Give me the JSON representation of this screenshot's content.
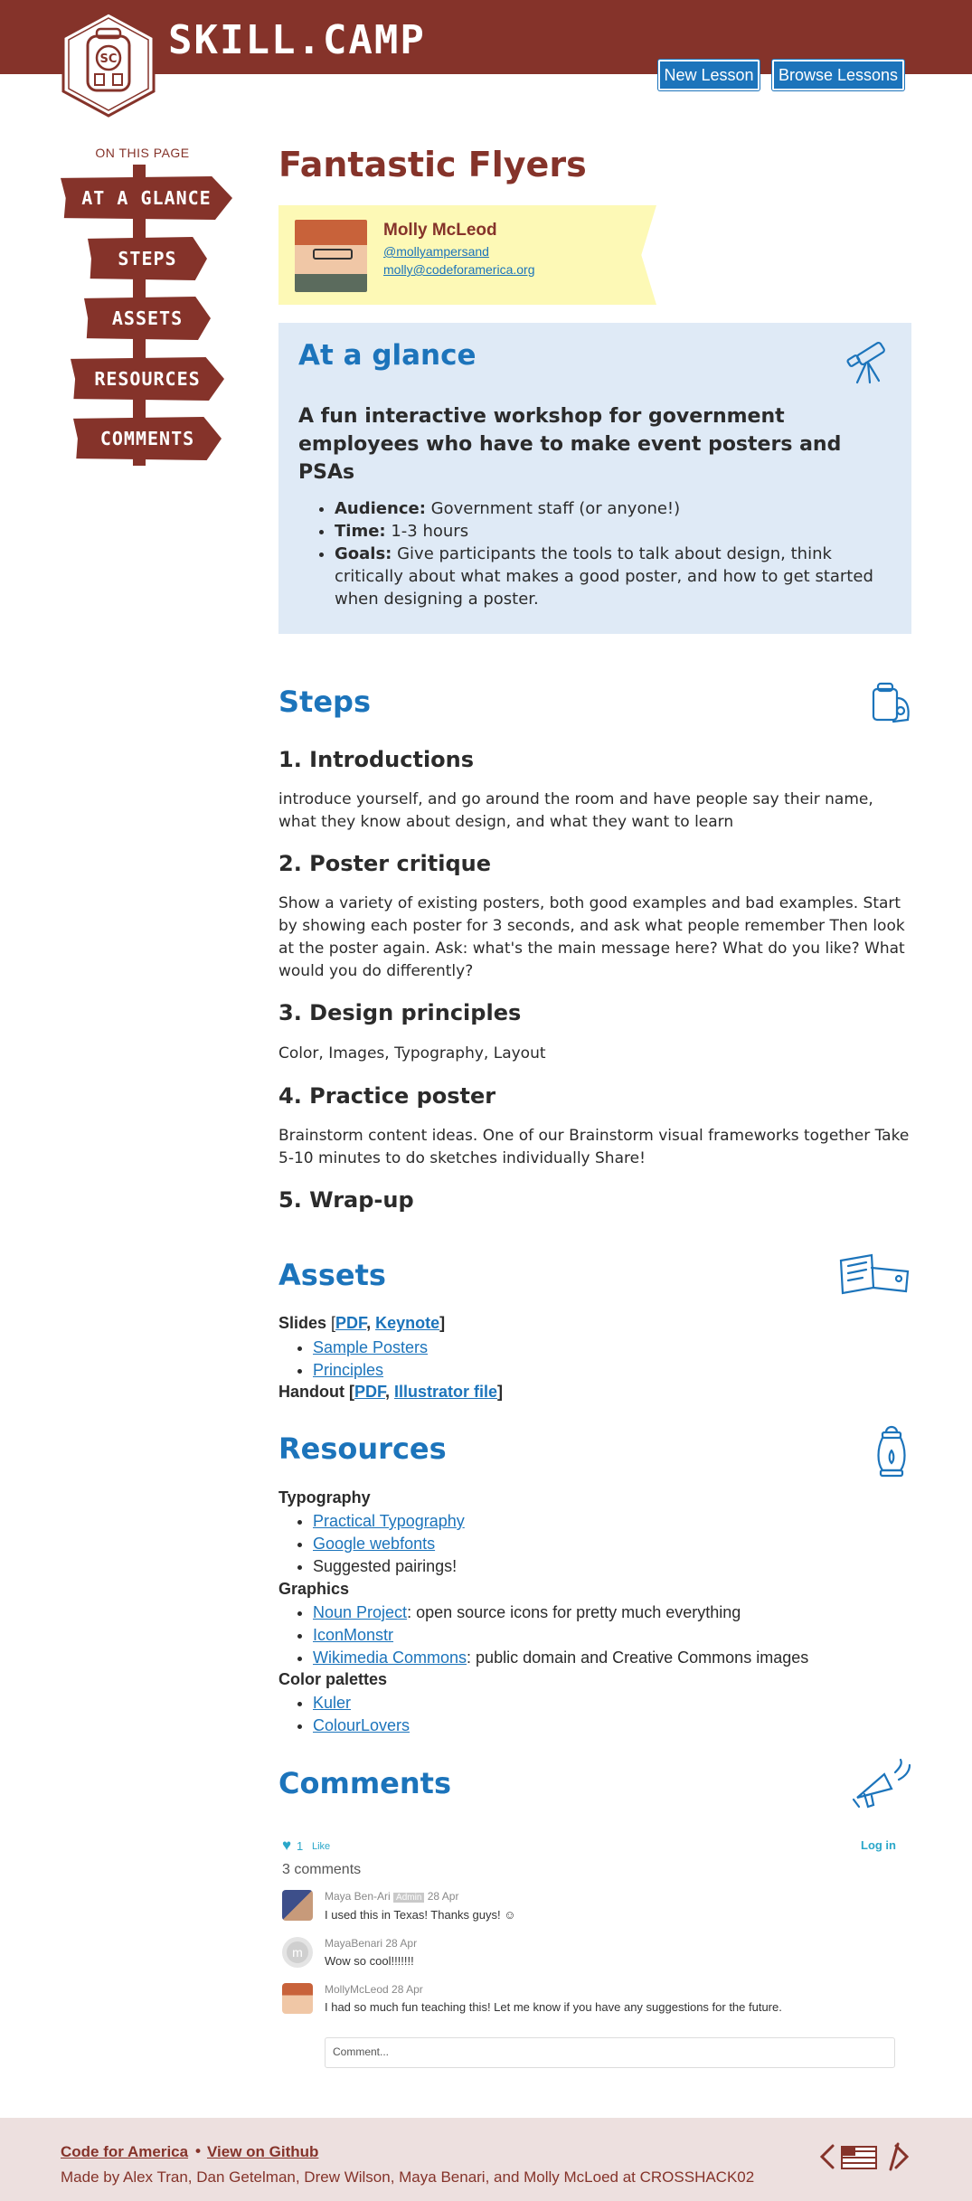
{
  "header": {
    "brand": "SKILL.CAMP",
    "badge_text": "SC",
    "new_lesson": "New Lesson",
    "browse_lessons": "Browse Lessons"
  },
  "nav": {
    "heading": "ON THIS PAGE",
    "items": [
      {
        "label": "AT A GLANCE"
      },
      {
        "label": "STEPS"
      },
      {
        "label": "ASSETS"
      },
      {
        "label": "RESOURCES"
      },
      {
        "label": "COMMENTS"
      }
    ]
  },
  "lesson": {
    "title": "Fantastic Flyers",
    "author": {
      "name": "Molly McLeod",
      "twitter": "@mollyampersand",
      "email": "molly@codeforamerica.org"
    }
  },
  "glance": {
    "heading": "At a glance",
    "summary": "A fun interactive workshop for government employees who have to make event posters and PSAs",
    "items": [
      {
        "label": "Audience:",
        "text": " Government staff (or anyone!)"
      },
      {
        "label": "Time:",
        "text": " 1-3 hours"
      },
      {
        "label": "Goals:",
        "text": " Give participants the tools to talk about design, think critically about what makes a good poster, and how to get started when designing a poster."
      }
    ]
  },
  "steps": {
    "heading": "Steps",
    "list": [
      {
        "title": "1. Introductions",
        "body": "introduce yourself, and go around the room and have people say their name, what they know about design, and what they want to learn"
      },
      {
        "title": "2. Poster critique",
        "body": "Show a variety of existing posters, both good examples and bad examples. Start by showing each poster for 3 seconds, and ask what people remember Then look at the poster again. Ask: what's the main message here? What do you like? What would you do differently?"
      },
      {
        "title": "3. Design principles",
        "body": "Color, Images, Typography, Layout"
      },
      {
        "title": "4. Practice poster",
        "body": "Brainstorm content ideas. One of our Brainstorm visual frameworks together Take 5-10 minutes to do sketches individually Share!"
      },
      {
        "title": "5. Wrap-up",
        "body": ""
      }
    ]
  },
  "assets": {
    "heading": "Assets",
    "slides_label": "Slides",
    "slides_pdf": "PDF",
    "slides_keynote": "Keynote",
    "slide_items": [
      "Sample Posters",
      "Principles"
    ],
    "handout_label": "Handout",
    "handout_pdf": "PDF",
    "handout_ai": "Illustrator file"
  },
  "resources": {
    "heading": "Resources",
    "typography_label": "Typography",
    "typography": [
      "Practical Typography",
      "Google webfonts",
      "Suggested pairings!"
    ],
    "graphics_label": "Graphics",
    "graphics": [
      {
        "link": "Noun Project",
        "text": ": open source icons for pretty much everything"
      },
      {
        "link": "IconMonstr",
        "text": ""
      },
      {
        "link": "Wikimedia Commons",
        "text": ": public domain and Creative Commons images"
      }
    ],
    "palettes_label": "Color palettes",
    "palettes": [
      "Kuler",
      "ColourLovers"
    ]
  },
  "comments": {
    "heading": "Comments",
    "like_count": "1",
    "like_label": "Like",
    "login": "Log in",
    "count_text": "3 comments",
    "list": [
      {
        "author": "Maya Ben-Ari",
        "badge": "Admin",
        "date": "28 Apr",
        "text": "I used this in Texas! Thanks guys! ☺"
      },
      {
        "author": "MayaBenari",
        "badge": "",
        "date": "28 Apr",
        "text": "Wow so cool!!!!!!!"
      },
      {
        "author": "MollyMcLeod",
        "badge": "",
        "date": "28 Apr",
        "text": "I had so much fun teaching this! Let me know if you have any suggestions for the future."
      }
    ],
    "input_placeholder": "Comment..."
  },
  "footer": {
    "cfa": "Code for America",
    "separator": "•",
    "github": "View on Github",
    "credit": "Made by Alex Tran, Dan Getelman, Drew Wilson, Maya Benari, and Molly McLoed at CROSSHACK02"
  },
  "colors": {
    "brand_red": "#85332a",
    "accent_blue": "#1c74bb",
    "glance_bg": "#dfeaf6",
    "author_bg": "#fdf9b6",
    "footer_bg": "#ede0df"
  }
}
